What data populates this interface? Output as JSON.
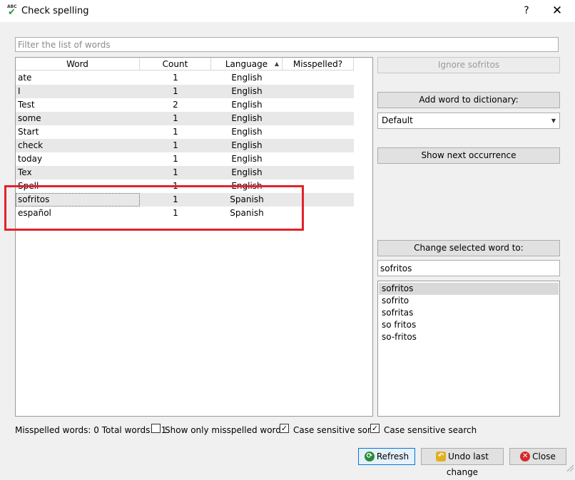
{
  "window": {
    "title": "Check spelling",
    "help_label": "?",
    "close_label": "✕"
  },
  "filter": {
    "placeholder": "Filter the list of words",
    "value": ""
  },
  "table": {
    "columns": [
      "Word",
      "Count",
      "Language",
      "Misspelled?"
    ],
    "sorted_column": "Language",
    "rows": [
      {
        "word": "ate",
        "count": "1",
        "language": "English",
        "misspelled": ""
      },
      {
        "word": "I",
        "count": "1",
        "language": "English",
        "misspelled": ""
      },
      {
        "word": "Test",
        "count": "2",
        "language": "English",
        "misspelled": ""
      },
      {
        "word": "some",
        "count": "1",
        "language": "English",
        "misspelled": ""
      },
      {
        "word": "Start",
        "count": "1",
        "language": "English",
        "misspelled": ""
      },
      {
        "word": "check",
        "count": "1",
        "language": "English",
        "misspelled": ""
      },
      {
        "word": "today",
        "count": "1",
        "language": "English",
        "misspelled": ""
      },
      {
        "word": "Tex",
        "count": "1",
        "language": "English",
        "misspelled": ""
      },
      {
        "word": "Spell",
        "count": "1",
        "language": "English",
        "misspelled": ""
      },
      {
        "word": "sofritos",
        "count": "1",
        "language": "Spanish",
        "misspelled": ""
      },
      {
        "word": "español",
        "count": "1",
        "language": "Spanish",
        "misspelled": ""
      }
    ],
    "selected_row": 9
  },
  "actions": {
    "ignore": "Ignore sofritos",
    "add_to_dictionary": "Add word to dictionary:",
    "dictionary_selected": "Default",
    "show_next": "Show next occurrence",
    "change_word": "Change selected word to:",
    "change_value": "sofritos"
  },
  "suggestions": [
    "sofritos",
    "sofrito",
    "sofritas",
    "so fritos",
    "so-fritos"
  ],
  "status": {
    "counts": "Misspelled words: 0 Total words: 11",
    "show_only_misspelled": {
      "label": "Show only misspelled words",
      "checked": false
    },
    "case_sensitive_sort": {
      "label": "Case sensitive sort",
      "checked": true
    },
    "case_sensitive_search": {
      "label": "Case sensitive search",
      "checked": true
    }
  },
  "buttons": {
    "refresh": "Refresh",
    "undo": "Undo last change",
    "close": "Close"
  },
  "colors": {
    "highlight_box": "#e2232a",
    "alt_row": "#e8e8e8",
    "check_icon": "#2a9a3a"
  }
}
